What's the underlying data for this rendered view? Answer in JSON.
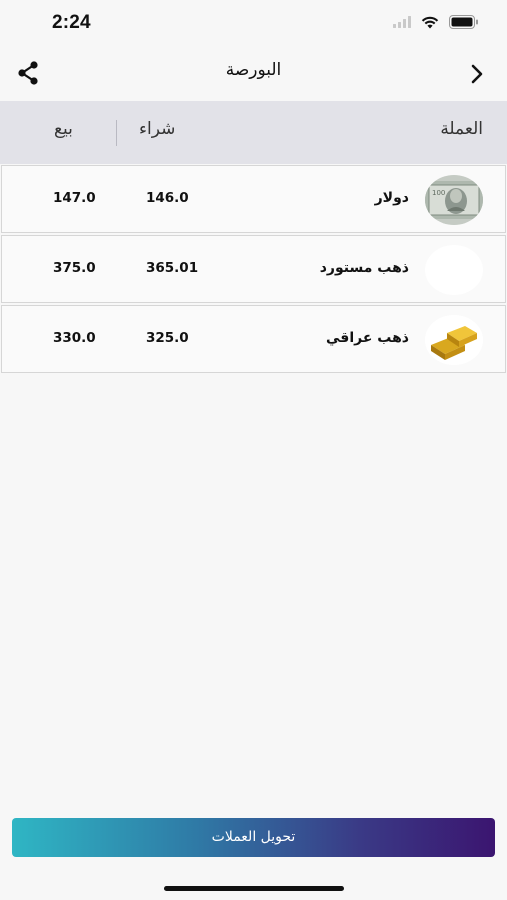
{
  "status_bar": {
    "time": "2:24",
    "signal_icon": "cellular-signal-icon",
    "wifi_icon": "wifi-icon",
    "battery_icon": "battery-icon"
  },
  "nav": {
    "title": "البورصة",
    "share_icon": "share-icon",
    "back_icon": "chevron-right-icon"
  },
  "table": {
    "headers": {
      "currency": "العملة",
      "buy": "شراء",
      "sell": "بيع"
    },
    "rows": [
      {
        "name": "دولار",
        "buy": "146.0",
        "sell": "147.0",
        "icon": "dollar-bill-thumbnail"
      },
      {
        "name": "ذهب مستورد",
        "buy": "365.01",
        "sell": "375.0",
        "icon": "blank-thumbnail"
      },
      {
        "name": "ذهب عراقي",
        "buy": "325.0",
        "sell": "330.0",
        "icon": "gold-bars-thumbnail"
      }
    ]
  },
  "footer": {
    "convert_label": "تحويل العملات"
  },
  "colors": {
    "header_bg": "#e2e2e8",
    "button_start": "#2fb6c4",
    "button_end": "#3b1570",
    "page_bg": "#f7f7f7"
  }
}
